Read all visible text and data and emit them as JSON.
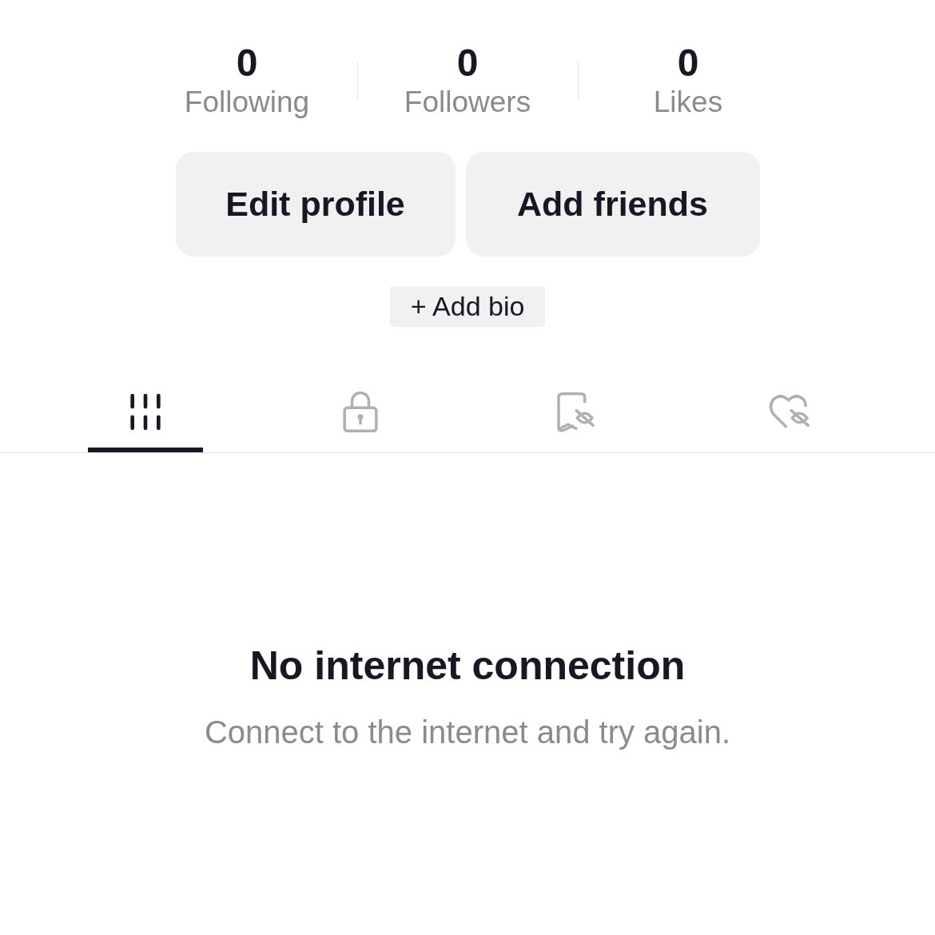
{
  "stats": [
    {
      "value": "0",
      "label": "Following"
    },
    {
      "value": "0",
      "label": "Followers"
    },
    {
      "value": "0",
      "label": "Likes"
    }
  ],
  "buttons": [
    "Edit profile",
    "Add friends"
  ],
  "bio_button": "+ Add bio",
  "tabs": [
    {
      "kind": "grid",
      "selected": true
    },
    {
      "kind": "lock",
      "selected": false
    },
    {
      "kind": "bookmark-hidden",
      "selected": false
    },
    {
      "kind": "heart-hidden",
      "selected": false
    }
  ],
  "empty_state": {
    "title": "No internet connection",
    "message": "Connect to the internet and try again."
  }
}
